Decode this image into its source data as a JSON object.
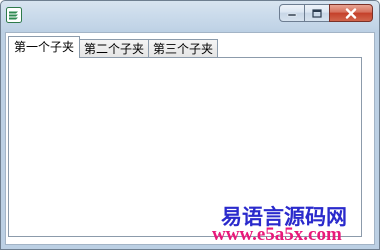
{
  "window": {
    "title": "",
    "icon": "easy-language-app-icon",
    "controls": [
      "minimize-icon",
      "maximize-icon",
      "close-icon"
    ]
  },
  "tabs": [
    {
      "label": "第一个子夹",
      "active": true
    },
    {
      "label": "第二个子夹",
      "active": false
    },
    {
      "label": "第三个子夹",
      "active": false
    }
  ],
  "watermark": {
    "site_name": "易语言源码网",
    "url": "www.e5a5x.com",
    "title_color": "#2a2acc",
    "url_color": "#e8197a"
  }
}
